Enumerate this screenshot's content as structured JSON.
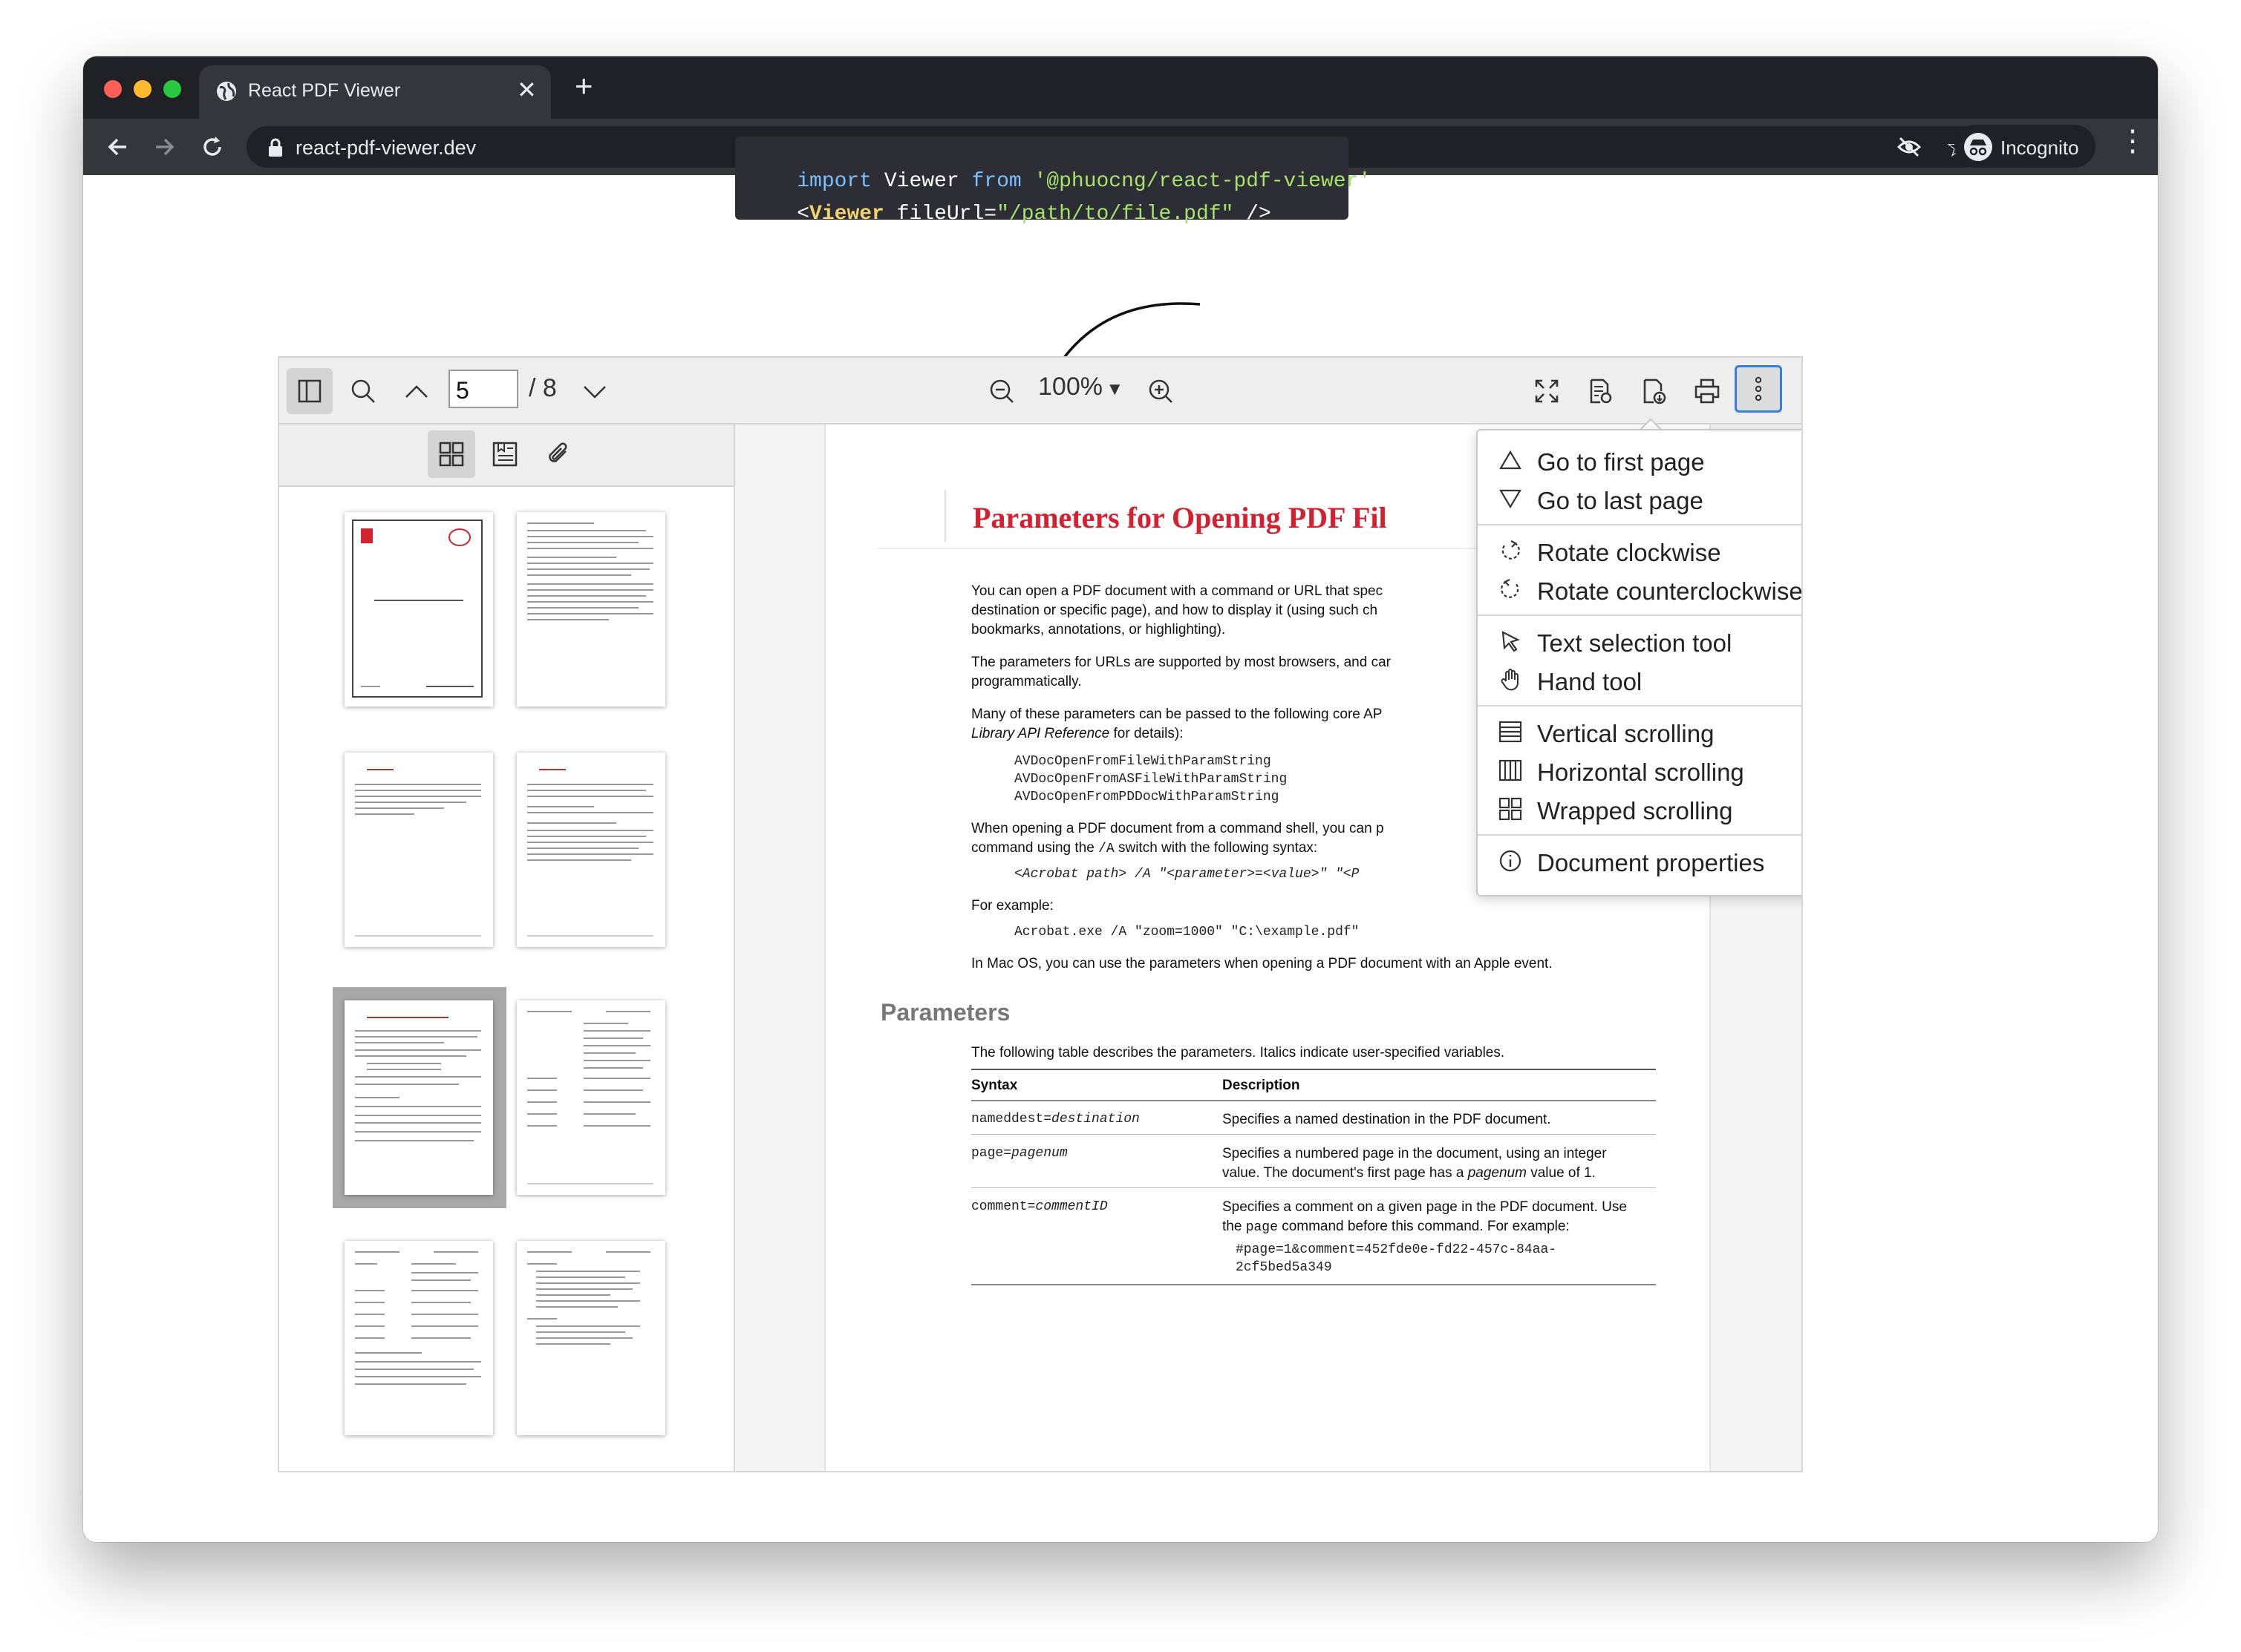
{
  "browser": {
    "tab_title": "React PDF Viewer",
    "tab_close": "✕",
    "new_tab": "+",
    "url": "react-pdf-viewer.dev",
    "incognito_label": "Incognito"
  },
  "code": {
    "line1_kw1": "import",
    "line1_name": " Viewer ",
    "line1_kw2": "from",
    "line1_str": " '@phuocng/react-pdf-viewer'",
    "line1_end": ";",
    "line2_open": "<",
    "line2_tag": "Viewer",
    "line2_attr": " fileUrl=",
    "line2_str": "\"/path/to/file.pdf\"",
    "line2_end": " />"
  },
  "toolbar": {
    "current_page": "5",
    "total_pages": "/ 8",
    "zoom_level": "100%"
  },
  "sidebar": {
    "selected_thumbnail": 5,
    "thumbnail_count": 8
  },
  "document": {
    "heading": "Parameters for Opening PDF Fil",
    "p1a": "You can open a PDF document with a command or URL that spec",
    "p1b": "destination or specific page), and how to display it (using such ch",
    "p1c": "bookmarks, annotations, or highlighting).",
    "p2a": "The parameters for URLs are supported by most browsers, and car",
    "p2b": "programmatically.",
    "p3a": "Many of these parameters can be passed to the following core AP",
    "p3b_italic": "Library API Reference",
    "p3b_rest": " for details):",
    "api1": "AVDocOpenFromFileWithParamString",
    "api2": "AVDocOpenFromASFileWithParamString",
    "api3": "AVDocOpenFromPDDocWithParamString",
    "p4a": "When opening a PDF document from a command shell, you can p",
    "p4b_pre": "command using the ",
    "p4b_code": "/A",
    "p4b_post": " switch with the following syntax:",
    "syntax": "<Acrobat path> /A \"<parameter>=<value>\" \"<P",
    "p5": "For example:",
    "example": "Acrobat.exe /A \"zoom=1000\" \"C:\\example.pdf\"",
    "p6": "In Mac OS, you can use the parameters when opening a PDF document with an Apple event.",
    "section": "Parameters",
    "p7": "The following table describes the parameters. Italics indicate user-specified variables.",
    "table": {
      "col1": "Syntax",
      "col2": "Description",
      "r1_syntax_pre": "nameddest=",
      "r1_syntax_var": "destination",
      "r1_desc": "Specifies a named destination in the PDF document.",
      "r2_syntax_pre": "page=",
      "r2_syntax_var": "pagenum",
      "r2_desc_a": "Specifies a numbered page in the document, using an integer",
      "r2_desc_b_pre": "value. The document's first page has a ",
      "r2_desc_b_var": "pagenum",
      "r2_desc_b_post": " value of 1.",
      "r3_syntax_pre": "comment=",
      "r3_syntax_var": "commentID",
      "r3_desc_a": "Specifies a comment on a given page in the PDF document. Use",
      "r3_desc_b_pre": "the ",
      "r3_desc_b_code": "page",
      "r3_desc_b_post": " command before this command. For example:",
      "r3_code_a": "#page=1&comment=452fde0e-fd22-457c-84aa-",
      "r3_code_b": "2cf5bed5a349"
    }
  },
  "menu": {
    "items": [
      {
        "label": "Go to first page",
        "icon": "triangle-up-icon",
        "checked": false
      },
      {
        "label": "Go to last page",
        "icon": "triangle-down-icon",
        "checked": false
      },
      {
        "label": "Rotate clockwise",
        "icon": "rotate-clockwise-icon",
        "checked": false
      },
      {
        "label": "Rotate counterclockwise",
        "icon": "rotate-counterclockwise-icon",
        "checked": false
      },
      {
        "label": "Text selection tool",
        "icon": "cursor-icon",
        "checked": true
      },
      {
        "label": "Hand tool",
        "icon": "hand-icon",
        "checked": false
      },
      {
        "label": "Vertical scrolling",
        "icon": "vertical-scroll-icon",
        "checked": true
      },
      {
        "label": "Horizontal scrolling",
        "icon": "horizontal-scroll-icon",
        "checked": false
      },
      {
        "label": "Wrapped scrolling",
        "icon": "wrapped-scroll-icon",
        "checked": false
      },
      {
        "label": "Document properties",
        "icon": "info-icon",
        "checked": false
      }
    ],
    "check_glyph": "✓"
  },
  "colors": {
    "heading_red": "#d4202f",
    "active_button_border": "#357edd",
    "code_bg": "#2d2d35"
  }
}
